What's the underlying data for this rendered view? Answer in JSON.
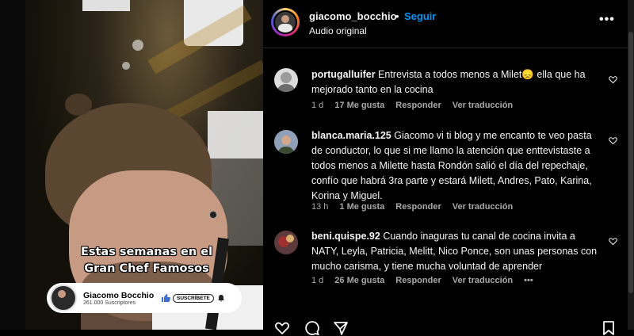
{
  "video": {
    "caption_line1": "Estas semanas en el",
    "caption_line2": "Gran Chef Famosos",
    "channel_name": "Giacomo Bocchio",
    "channel_subs": "261.000 Suscriptores",
    "subscribe_label": "SUSCRÍBETE"
  },
  "header": {
    "username": "giacomo_bocchio",
    "separator": "•",
    "follow_label": "Seguir",
    "audio_label": "Audio original",
    "more_label": "•••"
  },
  "comments": [
    {
      "username": "portugalluifer",
      "text": "Entrevista a todos menos a Milet😞 ella que ha mejorado tanto en la cocina",
      "time": "1 d",
      "likes": "17 Me gusta",
      "reply": "Responder",
      "translate": "Ver traducción"
    },
    {
      "username": "blanca.maria.125",
      "text": "Giacomo vi ti blog y me encanto te veo pasta de conductor, lo que si me llamo la atención que enttevistaste a todos menos a Milette hasta Rondón salió el día del repechaje, confío que habrá 3ra parte y estará Milett, Andres, Pato, Karina, Korina y Miguel.",
      "time": "13 h",
      "likes": "1 Me gusta",
      "reply": "Responder",
      "translate": "Ver traducción"
    },
    {
      "username": "beni.quispe.92",
      "text": "Cuando inaguras tu canal de cocina invita a NATY, Leyla, Patricia, Melitt, Nico Ponce, son unas personas con mucho carisma, y tiene mucha voluntad de aprender",
      "time": "1 d",
      "likes": "26 Me gusta",
      "reply": "Responder",
      "translate": "Ver traducción",
      "more": "•••"
    }
  ],
  "colors": {
    "accent": "#0095f6",
    "background": "#000000",
    "muted_text": "#a8a8a8"
  },
  "icons": [
    "heart-icon",
    "comment-icon",
    "share-icon",
    "bookmark-icon",
    "more-icon"
  ]
}
